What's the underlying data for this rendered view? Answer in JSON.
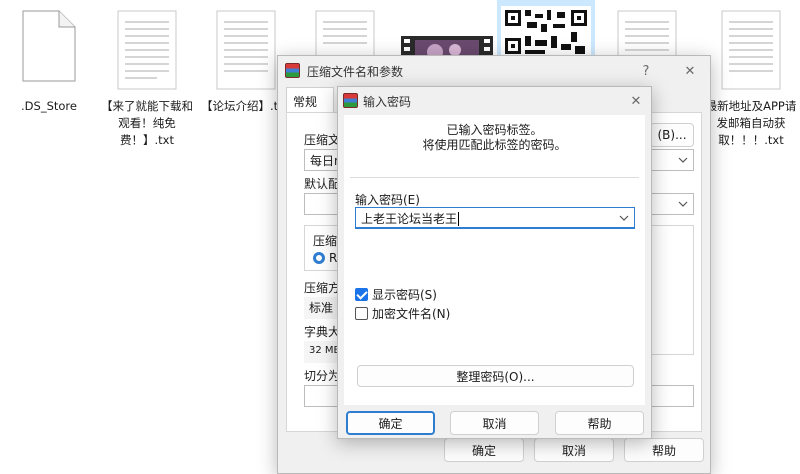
{
  "desktop": {
    "files": [
      {
        "name": ".DS_Store",
        "thumb": "blank-file-icon"
      },
      {
        "name": "【来了就能下载和观看！纯免费！】.txt",
        "thumb": "text-file-icon"
      },
      {
        "name": "【论坛介绍】.t",
        "thumb": "text-file-icon"
      },
      {
        "name": "",
        "thumb": "text-file-icon"
      },
      {
        "name": "",
        "thumb": "video-thumbnail-icon"
      },
      {
        "name": "",
        "thumb": "qr-code-image-icon"
      },
      {
        "name": "",
        "thumb": "text-file-icon"
      },
      {
        "name": "最新地址及APP请发邮箱自动获取！！！.txt",
        "thumb": "text-file-icon"
      }
    ]
  },
  "archive_dialog": {
    "title": "压缩文件名和参数",
    "help_glyph": "?",
    "close_glyph": "✕",
    "tab_general": "常规",
    "archive_name_label": "压缩文",
    "archive_name_value": "每日n",
    "browse_button": "(B)...",
    "default_profile_label": "默认配",
    "format_group_label": "压缩",
    "format_rar_label": "RA",
    "method_label": "压缩方",
    "method_value": "标准",
    "dict_label": "字典大",
    "dict_value": "32 MB",
    "split_label": "切分为",
    "ok_button": "确定",
    "cancel_button": "取消",
    "help_button": "帮助"
  },
  "password_dialog": {
    "title": "输入密码",
    "close_glyph": "✕",
    "info_line1": "已输入密码标签。",
    "info_line2": "将使用匹配此标签的密码。",
    "password_label": "输入密码(E)",
    "password_value": "上老王论坛当老王",
    "show_password_label": "显示密码(S)",
    "show_password_checked": true,
    "encrypt_filenames_label": "加密文件名(N)",
    "encrypt_filenames_checked": false,
    "organize_button": "整理密码(O)...",
    "ok_button": "确定",
    "cancel_button": "取消",
    "help_button": "帮助"
  },
  "colors": {
    "accent": "#2f7dd1",
    "dialog_bg": "#f0f0f0",
    "selection": "#cce8ff"
  }
}
